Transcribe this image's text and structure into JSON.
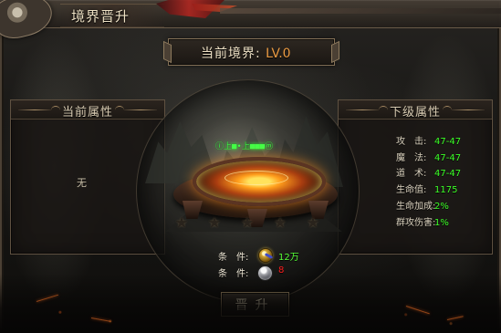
{
  "window": {
    "title": "境界晋升"
  },
  "current_realm": {
    "label": "当前境界:",
    "value": "LV.0"
  },
  "left_panel": {
    "title": "当前属性",
    "empty_text": "无"
  },
  "right_panel": {
    "title": "下级属性",
    "attributes": [
      {
        "label": "攻　击:",
        "value": "47-47"
      },
      {
        "label": "魔　法:",
        "value": "47-47"
      },
      {
        "label": "道　术:",
        "value": "47-47"
      },
      {
        "label": "生命值:",
        "value": "1175"
      },
      {
        "label": "生命加成:",
        "value": "2%"
      },
      {
        "label": "群攻伤害:",
        "value": "1%"
      }
    ]
  },
  "center": {
    "glyph_text": "ⓘ上■•上■■■ⓜ",
    "stars": [
      "★",
      "★",
      "★",
      "★",
      "★"
    ]
  },
  "requirements": [
    {
      "label": "条　件:",
      "icon": "gold-coin-icon",
      "value": "12万"
    },
    {
      "label": "条　件:",
      "icon": "stone-icon",
      "value": "8"
    }
  ],
  "actions": {
    "upgrade_label": "晋升"
  },
  "colors": {
    "green": "#3cff27",
    "orange": "#ea9a42",
    "red": "#ff1e1e",
    "gold_border": "#9b8563"
  }
}
